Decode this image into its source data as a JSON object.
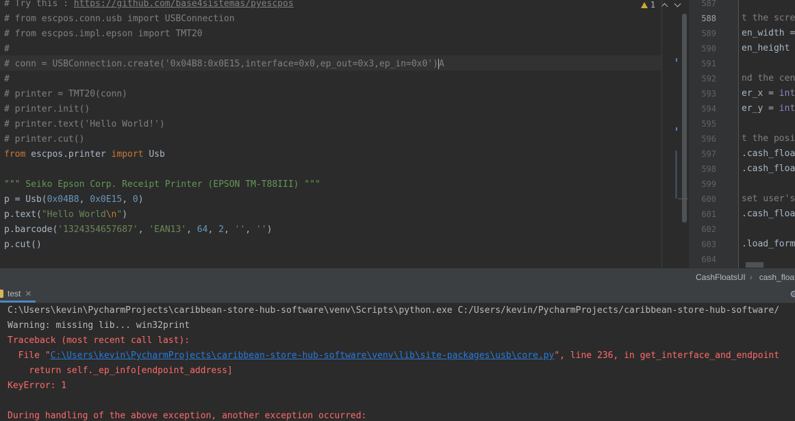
{
  "editor": {
    "inspection": {
      "count": "1"
    },
    "lines": [
      [
        [
          "c-comment",
          "# Try this : "
        ],
        [
          "c-link",
          "https://github.com/base4sistemas/pyescpos"
        ]
      ],
      [
        [
          "c-comment",
          "# from escpos.conn.usb import USBConnection"
        ]
      ],
      [
        [
          "c-comment",
          "# from escpos.impl.epson import TMT20"
        ]
      ],
      [
        [
          "c-comment",
          "#"
        ]
      ],
      [
        [
          "c-comment",
          "# conn = USBConnection.create('0x04B8:0x0E15,interface=0x0,ep_out=0x3,ep_in=0x0')"
        ],
        [
          "c-comment",
          "A"
        ]
      ],
      [
        [
          "c-comment",
          "#"
        ]
      ],
      [
        [
          "c-comment",
          "# printer = TMT20(conn)"
        ]
      ],
      [
        [
          "c-comment",
          "# printer.init()"
        ]
      ],
      [
        [
          "c-comment",
          "# printer.text('Hello World!')"
        ]
      ],
      [
        [
          "c-comment",
          "# printer.cut()"
        ]
      ],
      [
        [
          "c-keyword",
          "from "
        ],
        [
          "",
          "escpos.printer "
        ],
        [
          "c-keyword",
          "import "
        ],
        [
          "",
          "Usb"
        ]
      ],
      [
        [
          "",
          ""
        ]
      ],
      [
        [
          "c-docstring",
          "\"\"\" Seiko Epson Corp. Receipt Printer (EPSON TM-T88III) \"\"\""
        ]
      ],
      [
        [
          "",
          "p = Usb("
        ],
        [
          "c-number",
          "0x04B8"
        ],
        [
          "",
          ", "
        ],
        [
          "c-number",
          "0x0E15"
        ],
        [
          "",
          ", "
        ],
        [
          "c-number",
          "0"
        ],
        [
          "",
          ")"
        ]
      ],
      [
        [
          "",
          "p.text("
        ],
        [
          "c-string",
          "\"Hello World"
        ],
        [
          "c-escape",
          "\\n"
        ],
        [
          "c-string",
          "\""
        ],
        [
          "",
          ")"
        ]
      ],
      [
        [
          "",
          "p.barcode("
        ],
        [
          "c-string",
          "'1324354657687'"
        ],
        [
          "",
          ", "
        ],
        [
          "c-string",
          "'EAN13'"
        ],
        [
          "",
          ", "
        ],
        [
          "c-number",
          "64"
        ],
        [
          "",
          ", "
        ],
        [
          "c-number",
          "2"
        ],
        [
          "",
          ", "
        ],
        [
          "c-string",
          "''"
        ],
        [
          "",
          ", "
        ],
        [
          "c-string",
          "''"
        ],
        [
          "",
          ")"
        ]
      ],
      [
        [
          "",
          "p.cut()"
        ]
      ]
    ]
  },
  "right_editor": {
    "line_numbers": [
      "587",
      "588",
      "589",
      "590",
      "591",
      "592",
      "593",
      "594",
      "595",
      "596",
      "597",
      "598",
      "599",
      "600",
      "601",
      "602",
      "603",
      "604"
    ],
    "active_line": "588",
    "code": [
      [
        [
          "",
          ""
        ]
      ],
      [
        [
          "c-comment",
          "t the scre"
        ]
      ],
      [
        [
          "",
          "en_width ="
        ]
      ],
      [
        [
          "",
          "en_height "
        ]
      ],
      [
        [
          "",
          ""
        ]
      ],
      [
        [
          "c-comment",
          "nd the cen"
        ]
      ],
      [
        [
          "",
          "er_x = "
        ],
        [
          "builtin",
          "int"
        ]
      ],
      [
        [
          "",
          "er_y = "
        ],
        [
          "builtin",
          "int"
        ]
      ],
      [
        [
          "",
          ""
        ]
      ],
      [
        [
          "c-comment",
          "t the posi"
        ]
      ],
      [
        [
          "",
          ".cash_floa"
        ]
      ],
      [
        [
          "",
          ".cash_floa"
        ]
      ],
      [
        [
          "",
          ""
        ]
      ],
      [
        [
          "c-comment",
          "set user's"
        ]
      ],
      [
        [
          "",
          ".cash_floa"
        ]
      ],
      [
        [
          "",
          ""
        ]
      ],
      [
        [
          "",
          ".load_form"
        ]
      ],
      [
        [
          "",
          ""
        ]
      ]
    ]
  },
  "breadcrumb": {
    "class_name": "CashFloatsUI",
    "method_name": "cash_floats"
  },
  "run": {
    "tab_label": "test",
    "console": [
      [
        [
          "con-normal",
          "C:\\Users\\kevin\\PycharmProjects\\caribbean-store-hub-software\\venv\\Scripts\\python.exe C:/Users/kevin/PycharmProjects/caribbean-store-hub-software/"
        ]
      ],
      [
        [
          "con-normal",
          "Warning: missing lib... win32print"
        ]
      ],
      [
        [
          "con-error",
          "Traceback (most recent call last):"
        ]
      ],
      [
        [
          "con-error",
          "  File \""
        ],
        [
          "con-link",
          "C:\\Users\\kevin\\PycharmProjects\\caribbean-store-hub-software\\venv\\lib\\site-packages\\usb\\core.py"
        ],
        [
          "con-error",
          "\", line 236, in get_interface_and_endpoint"
        ]
      ],
      [
        [
          "con-error",
          "    return self._ep_info[endpoint_address]"
        ]
      ],
      [
        [
          "con-error",
          "KeyError: 1"
        ]
      ],
      [
        [
          "con-error",
          ""
        ]
      ],
      [
        [
          "con-error",
          "During handling of the above exception, another exception occurred:"
        ]
      ]
    ]
  },
  "colors": {
    "background": "#2b2b2b",
    "comment": "#808080",
    "keyword": "#cc7832",
    "string": "#6a8759",
    "number": "#6897bb",
    "error": "#ff6b68",
    "link": "#287bde",
    "accent": "#4a88c7"
  },
  "icons": [
    "warning-icon",
    "chevron-up-icon",
    "chevron-down-icon",
    "python-file-icon",
    "close-icon",
    "gear-icon"
  ]
}
